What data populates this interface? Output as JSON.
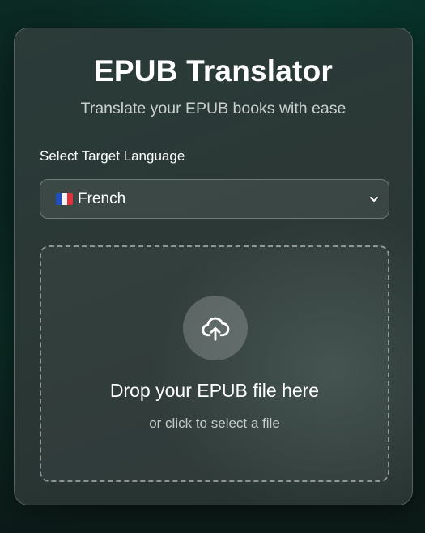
{
  "app": {
    "title": "EPUB Translator",
    "subtitle": "Translate your EPUB books with ease"
  },
  "language": {
    "label": "Select Target Language",
    "selected": "French",
    "selected_flag": "flag-france-icon"
  },
  "dropzone": {
    "icon": "cloud-upload-icon",
    "title": "Drop your EPUB file here",
    "subtitle": "or click to select a file"
  }
}
